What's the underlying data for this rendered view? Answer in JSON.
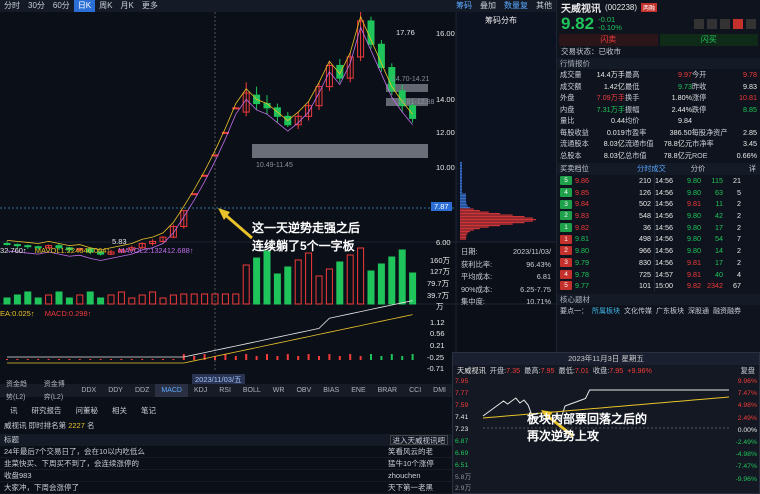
{
  "toolbar": {
    "items": [
      "分时",
      "30分",
      "60分",
      "日K",
      "周K",
      "月K",
      "更多"
    ],
    "active": 3,
    "right": [
      "筹码",
      "叠加",
      "数量复",
      "其他"
    ]
  },
  "chip_panel": {
    "title": "筹码分布"
  },
  "price_axis": [
    "16.00",
    "14.00",
    "12.00",
    "10.00",
    "8.00",
    "6.00"
  ],
  "annotations": {
    "high": "17.76",
    "low": "5.83",
    "box1": "14.70-14.21",
    "box2": "13.81-12.88",
    "box3": "10.49-11.45",
    "current_line": "7.87",
    "callout1_line1": "这一天逆势走强之后",
    "callout1_line2": "连续躺了5个一字板",
    "callout2_line1": "板块内部票回落之后的",
    "callout2_line2": "再次逆势上攻"
  },
  "chip_stats": {
    "date_label": "日期:",
    "date": "2023/11/03/",
    "profit_label": "获利比率:",
    "profit": "96.43%",
    "avg_label": "平均成本:",
    "avg": "6.81",
    "range_label": "90%成本:",
    "range": "6.25-7.75",
    "conc_label": "集中度:",
    "conc": "10.71%"
  },
  "vol_indicator": {
    "vol": "32.760↑",
    "mavol1": "MAVOL1:224646.064↑",
    "mavol2": "MAVOL2:132412.688↑",
    "axis": [
      "160万",
      "127万",
      "79.7万",
      "39.7万",
      "万"
    ]
  },
  "macd_indicator": {
    "dea": "EA:0.025↑",
    "macd": "MACD:0.298↑",
    "axis": [
      "1.12",
      "0.56",
      "0.21",
      "-0.25",
      "-0.71"
    ]
  },
  "date_marker": "2023/11/03/五",
  "indicator_tabs": [
    "资金趋势(L2)",
    "资金博弈(L2)",
    "DDX",
    "DDY",
    "DDZ",
    "MACD",
    "KDJ",
    "RSI",
    "BOLL",
    "WR",
    "OBV",
    "BIAS",
    "ENE",
    "BRAR",
    "CCI",
    "DMI"
  ],
  "indicator_active": 5,
  "sub_tabs": [
    "讯",
    "研究报告",
    "问董秘",
    "相关",
    "笔记"
  ],
  "rank": {
    "prefix": "威视讯 即时排名第",
    "num": "2227",
    "suffix": "名"
  },
  "news": {
    "header": "标题",
    "btn": "进入天威视讯吧",
    "rows": [
      {
        "t": "24年最后7个交易日了，会在10以内吃低么",
        "s": "笑看风云的老"
      },
      {
        "t": "韭菜快买、下周买不到了，会连续涨停的",
        "s": "猛牛10个涨停"
      },
      {
        "t": "收盘983",
        "s": "zhouchen"
      },
      {
        "t": "大家冲，下周会涨停了",
        "s": "天下第一老黑"
      }
    ]
  },
  "quote": {
    "name": "天威视讯",
    "code": "(002238)",
    "tag": "两融",
    "price": "9.82",
    "chg": "-0.01",
    "pct": "-0.10%",
    "btn_l": "闪卖",
    "btn_r": "闪买",
    "status": "交易状态：已收市",
    "section": "行情报价"
  },
  "stats": [
    [
      [
        "成交量",
        "14.4万手"
      ],
      [
        "最高",
        "9.97"
      ],
      [
        "今开",
        "9.78"
      ]
    ],
    [
      [
        "成交额",
        "1.42亿"
      ],
      [
        "最低",
        "9.73"
      ],
      [
        "昨收",
        "9.83"
      ]
    ],
    [
      [
        "外盘",
        "7.09万手"
      ],
      [
        "换手",
        "1.80%"
      ],
      [
        "涨停",
        "10.81"
      ]
    ],
    [
      [
        "内盘",
        "7.31万手"
      ],
      [
        "振幅",
        "2.44%"
      ],
      [
        "跌停",
        "8.85"
      ]
    ],
    [
      [
        "量比",
        "0.44"
      ],
      [
        "均价",
        "9.84"
      ],
      [
        "",
        ""
      ]
    ],
    [
      [
        "每股收益",
        "0.019"
      ],
      [
        "市盈率",
        "386.50"
      ],
      [
        "每股净资产",
        "2.85"
      ]
    ],
    [
      [
        "流通股本",
        "8.03亿"
      ],
      [
        "流通市值",
        "78.8亿元"
      ],
      [
        "市净率",
        "3.45"
      ]
    ],
    [
      [
        "总股本",
        "8.03亿"
      ],
      [
        "总市值",
        "78.8亿元"
      ],
      [
        "ROE",
        "0.66%"
      ]
    ]
  ],
  "ob_tabs": [
    "买卖档位",
    "分时成交",
    "分价",
    "详"
  ],
  "asks": [
    {
      "lv": "5",
      "p": "9.86",
      "v": "210"
    },
    {
      "lv": "4",
      "p": "9.85",
      "v": "126"
    },
    {
      "lv": "3",
      "p": "9.84",
      "v": "502"
    },
    {
      "lv": "2",
      "p": "9.83",
      "v": "548"
    },
    {
      "lv": "1",
      "p": "9.82",
      "v": "36"
    }
  ],
  "bids": [
    {
      "lv": "1",
      "p": "9.81",
      "v": "498"
    },
    {
      "lv": "2",
      "p": "9.80",
      "v": "966"
    },
    {
      "lv": "3",
      "p": "9.79",
      "v": "830"
    },
    {
      "lv": "4",
      "p": "9.78",
      "v": "725"
    },
    {
      "lv": "5",
      "p": "9.77",
      "v": "101"
    }
  ],
  "ticks": [
    [
      "14:56",
      "9.80",
      "115",
      "21"
    ],
    [
      "14:56",
      "9.80",
      "63",
      "5"
    ],
    [
      "14:56",
      "9.81",
      "11",
      "2"
    ],
    [
      "14:56",
      "9.80",
      "42",
      "2"
    ],
    [
      "14:56",
      "9.80",
      "17",
      "2"
    ],
    [
      "14:56",
      "9.80",
      "54",
      "7"
    ],
    [
      "14:56",
      "9.80",
      "14",
      "2"
    ],
    [
      "14:56",
      "9.81",
      "17",
      "2"
    ],
    [
      "14:57",
      "9.81",
      "40",
      "4"
    ],
    [
      "15:00",
      "9.82",
      "2342",
      "67"
    ]
  ],
  "concept": {
    "section": "核心题材",
    "label": "要点一：",
    "tags": [
      "所属板块",
      "文化传媒",
      "广东板块",
      "深股通",
      "融资融券"
    ]
  },
  "mini": {
    "date": "2023年11月3日 星期五",
    "name": "天威视讯",
    "open_l": "开盘:",
    "open": "7.35",
    "high_l": "最高:",
    "high": "7.95",
    "low_l": "最低:",
    "low": "7.01",
    "close_l": "收盘:",
    "close": "7.95",
    "pct": "+9.96%",
    "fq": "复盘",
    "left_axis": [
      "7.95",
      "7.77",
      "7.59",
      "7.41",
      "7.23",
      "6.87",
      "6.69",
      "6.51"
    ],
    "right_axis": [
      "9.96%",
      "7.47%",
      "4.98%",
      "2.49%",
      "0.00%",
      "-2.49%",
      "-4.98%",
      "-7.47%",
      "-9.96%"
    ],
    "vol_l": "5.8万",
    "vol_r": "2.9万"
  }
}
